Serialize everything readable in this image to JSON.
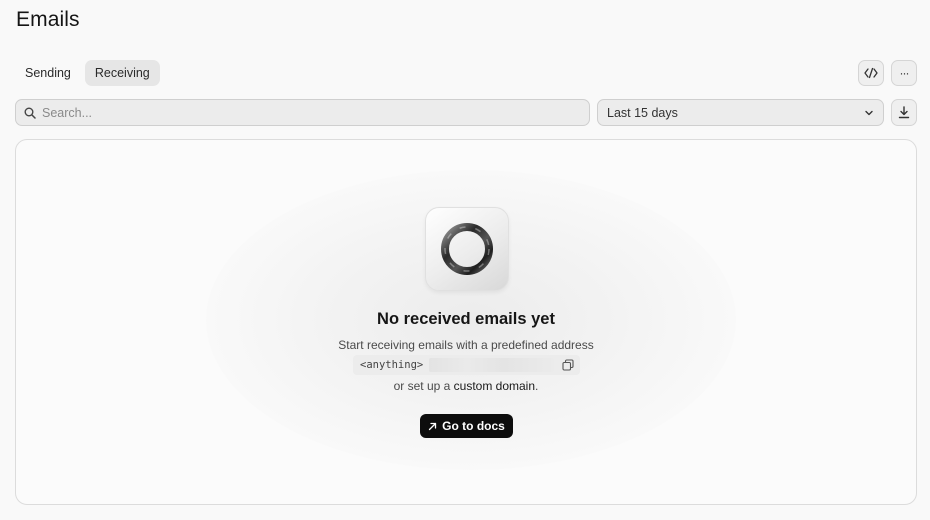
{
  "page": {
    "title": "Emails"
  },
  "tabs": [
    {
      "label": "Sending",
      "active": false
    },
    {
      "label": "Receiving",
      "active": true
    }
  ],
  "toolbar": {
    "code_icon": "code-icon",
    "more_icon": "ellipsis-icon",
    "more_glyph": "···",
    "download_icon": "download-icon"
  },
  "search": {
    "placeholder": "Search...",
    "value": ""
  },
  "date_filter": {
    "value": "Last 15 days"
  },
  "empty_state": {
    "logo_icon": "ring-logo-icon",
    "title": "No received emails yet",
    "subtitle": "Start receiving emails with a predefined address",
    "address_prefix": "<anything>",
    "or_text": "or set up a",
    "link_text": "custom domain",
    "period": ".",
    "button_label": "Go to docs"
  },
  "colors": {
    "accent": "#0d0d0d",
    "background": "#f9f9f9",
    "panel": "#fbfbfb"
  }
}
